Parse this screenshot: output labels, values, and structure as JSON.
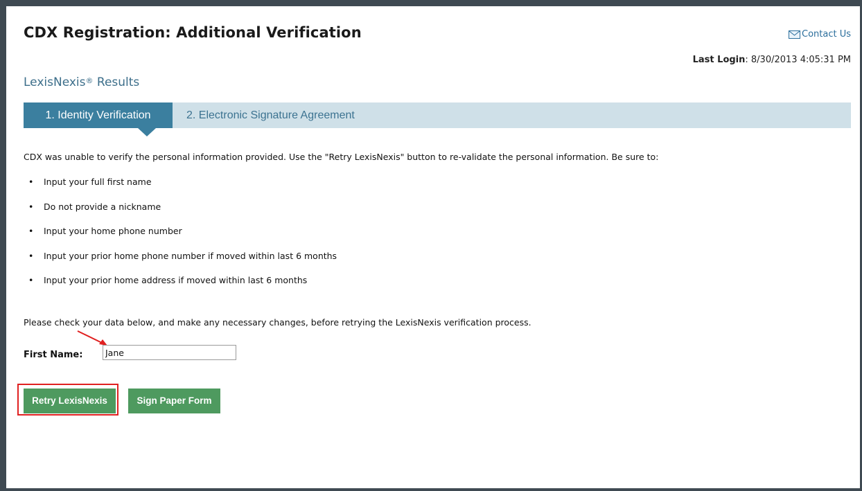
{
  "header": {
    "title": "CDX Registration: Additional Verification",
    "contact_label": "Contact Us",
    "last_login_label": "Last Login",
    "last_login_value": ": 8/30/2013 4:05:31 PM"
  },
  "section": {
    "title": "LexisNexis",
    "registered_mark": "®",
    "title_suffix": " Results"
  },
  "steps": [
    {
      "label": "1. Identity Verification",
      "active": true
    },
    {
      "label": "2. Electronic Signature Agreement",
      "active": false
    }
  ],
  "intro_text": "CDX was unable to verify the personal information provided. Use the \"Retry LexisNexis\" button to re-validate the personal information. Be sure to:",
  "requirements": [
    "Input your full first name",
    "Do not provide a nickname",
    "Input your home phone number",
    "Input your prior home phone number if moved within last 6 months",
    "Input your prior home address if moved within last 6 months"
  ],
  "bullet": "•",
  "check_text": "Please check your data below, and make any necessary changes, before retrying the LexisNexis verification process.",
  "form": {
    "first_name_label": "First Name:",
    "first_name_value": "Jane"
  },
  "buttons": {
    "retry": "Retry LexisNexis",
    "sign_paper": "Sign Paper Form"
  },
  "colors": {
    "accent": "#3b7f9f",
    "button": "#4e9a5f",
    "highlight": "#e02020",
    "step_bar": "#cfe0e8",
    "link": "#2b6e9c"
  },
  "icons": {
    "contact": "envelope-icon",
    "annotation": "red-arrow-icon"
  }
}
